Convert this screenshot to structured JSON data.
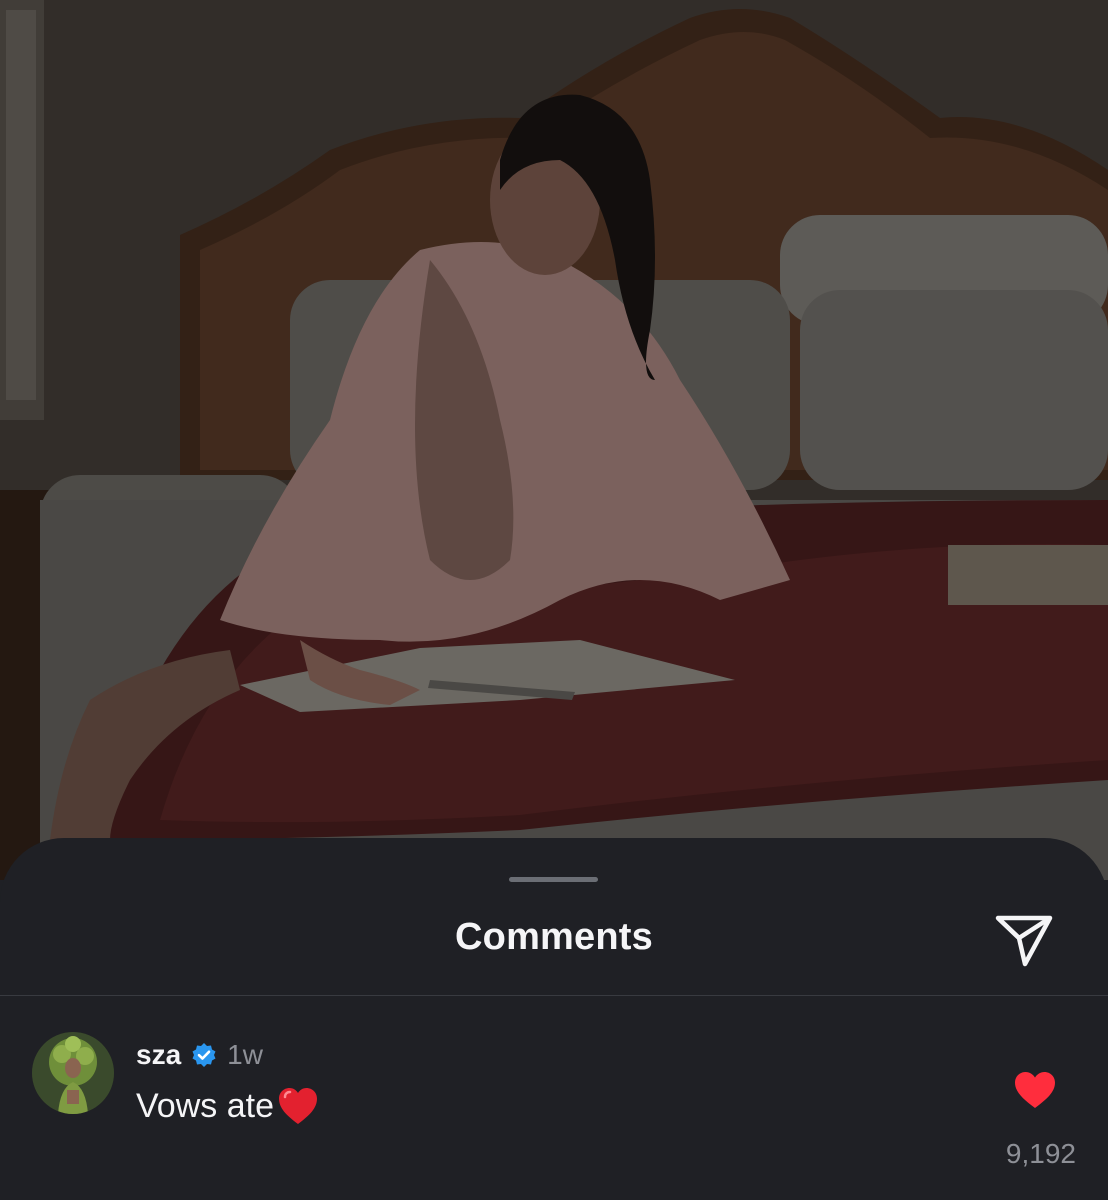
{
  "sheet": {
    "title": "Comments"
  },
  "comment": {
    "username": "sza",
    "verified": true,
    "time": "1w",
    "text": "Vows ate",
    "likes": "9,192",
    "liked": true
  },
  "icons": {
    "share": "paper-plane-icon",
    "like": "heart-filled-icon",
    "verified": "verified-badge-icon",
    "emoji": "red-heart-emoji"
  },
  "colors": {
    "sheet_bg": "#1f2025",
    "text_primary": "#f5f5f7",
    "text_secondary": "#8e9097",
    "like_red": "#ff2d3d",
    "verified_blue": "#2a96ef"
  }
}
